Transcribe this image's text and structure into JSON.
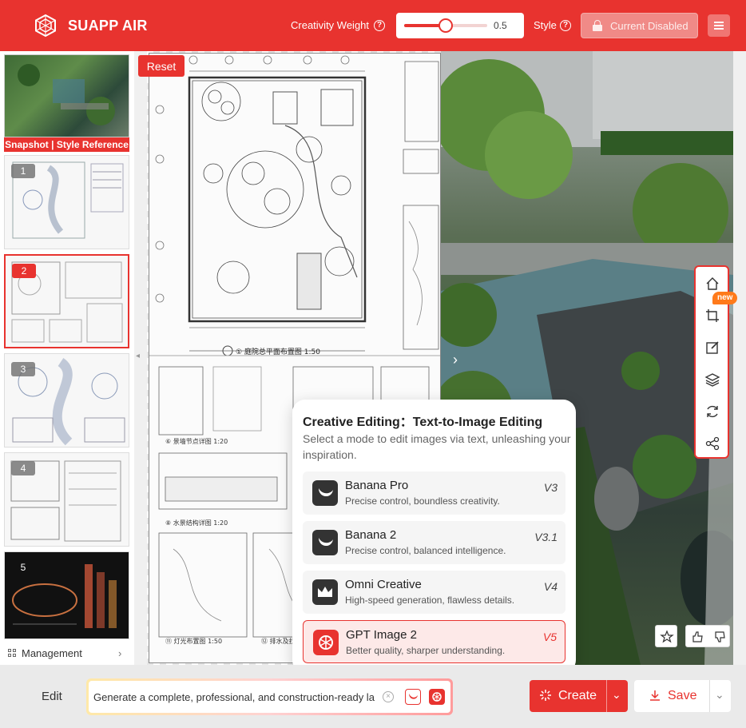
{
  "header": {
    "brand": "SUAPP AIR",
    "creativity_label": "Creativity Weight",
    "creativity_value": "0.5",
    "creativity_fraction": 0.5,
    "style_label": "Style",
    "disabled_button": "Current Disabled"
  },
  "sidebar": {
    "snapshot_caption": "Snapshot | Style Reference",
    "thumbs": [
      {
        "num": "1"
      },
      {
        "num": "2"
      },
      {
        "num": "3"
      },
      {
        "num": "4"
      },
      {
        "num": "5"
      }
    ],
    "management_label": "Management"
  },
  "canvas": {
    "reset_label": "Reset",
    "new_badge": "new"
  },
  "popup": {
    "title": "Creative Editing：Text-to-Image Editing",
    "description": "Select a mode to edit images via text, unleashing your inspiration.",
    "models": [
      {
        "name": "Banana Pro",
        "desc": "Precise control, boundless creativity.",
        "version": "V3"
      },
      {
        "name": "Banana 2",
        "desc": "Precise control, balanced intelligence.",
        "version": "V3.1"
      },
      {
        "name": "Omni Creative",
        "desc": "High-speed generation, flawless details.",
        "version": "V4"
      },
      {
        "name": "GPT Image 2",
        "desc": "Better quality, sharper understanding.",
        "version": "V5"
      }
    ]
  },
  "bottom": {
    "edit_label": "Edit",
    "prompt_value": "Generate a complete, professional, and construction-ready la",
    "create_label": "Create",
    "save_label": "Save"
  },
  "colors": {
    "accent": "#e8332f",
    "badge": "#ff7a1a"
  }
}
